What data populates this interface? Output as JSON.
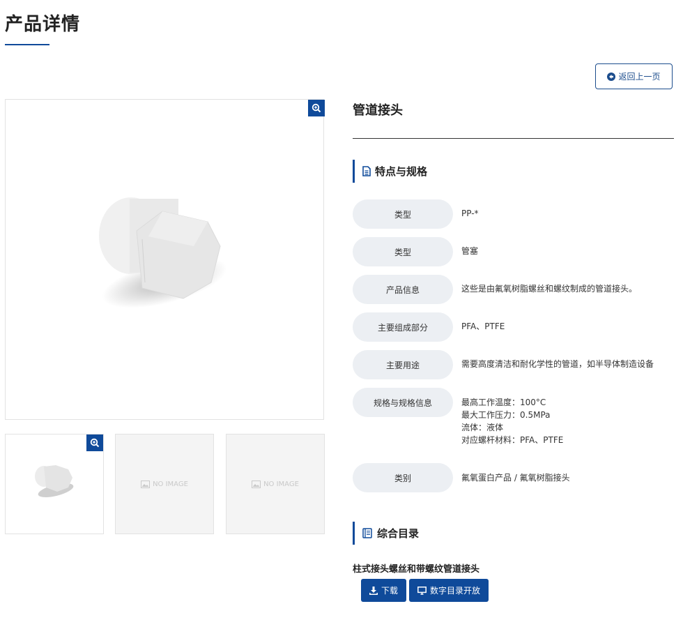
{
  "page": {
    "title": "产品详情"
  },
  "back_button": {
    "label": "返回上一页"
  },
  "gallery": {
    "no_image_label": "NO IMAGE"
  },
  "product": {
    "name": "管道接头"
  },
  "specs_section": {
    "title": "特点与规格"
  },
  "specs": [
    {
      "label": "类型",
      "value": [
        "PP-*"
      ]
    },
    {
      "label": "类型",
      "value": [
        "管塞"
      ]
    },
    {
      "label": "产品信息",
      "value": [
        "这些是由氟氧树脂螺丝和螺纹制成的管道接头。"
      ]
    },
    {
      "label": "主要组成部分",
      "value": [
        "PFA、PTFE"
      ]
    },
    {
      "label": "主要用途",
      "value": [
        "需要高度清洁和耐化学性的管道，如半导体制造设备"
      ]
    },
    {
      "label": "规格与规格信息",
      "value": [
        "最高工作温度：100°C",
        "最大工作压力：0.5MPa",
        "流体：液体",
        "对应螺杆材料：PFA、PTFE"
      ]
    },
    {
      "label": "类别",
      "value": [
        "氟氧蛋白产品 / 氟氧树脂接头"
      ]
    }
  ],
  "catalog_section": {
    "title": "综合目录",
    "item_title": "柱式接头螺丝和带螺纹管道接头",
    "download_label": "下载",
    "digital_label": "数字目录开放"
  },
  "colors": {
    "accent": "#0f4a9a",
    "label_bg": "#eceff3"
  }
}
